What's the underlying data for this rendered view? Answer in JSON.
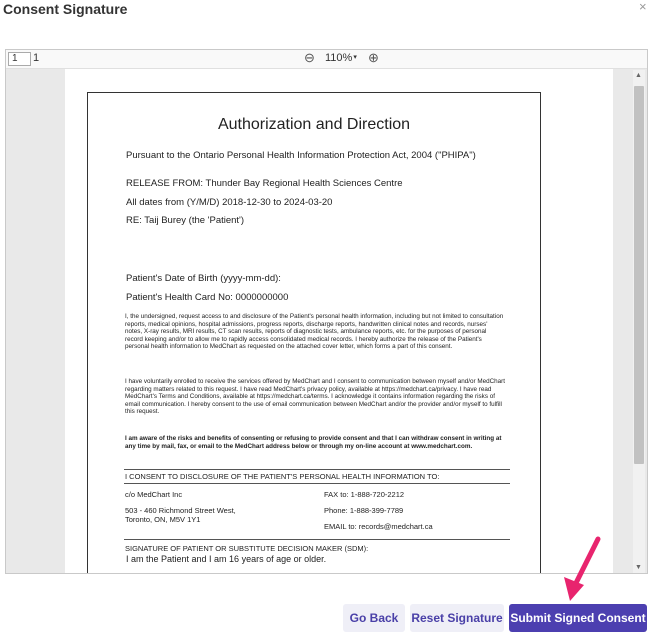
{
  "dialog": {
    "title": "Consent Signature",
    "close_label": "×"
  },
  "viewer": {
    "page_current": "1",
    "page_total": "1",
    "zoom_out_icon": "⊖",
    "zoom": "110%",
    "zoom_caret": "▾",
    "zoom_in_icon": "⊕",
    "scroll_up": "▲",
    "scroll_down": "▼"
  },
  "document": {
    "title": "Authorization and Direction",
    "pursuant": "Pursuant to the Ontario Personal Health Information Protection Act, 2004 (\"PHIPA\")",
    "release_from": "RELEASE FROM: Thunder Bay Regional Health Sciences Centre",
    "dates": "All dates from (Y/M/D) 2018-12-30 to 2024-03-20",
    "re": "RE: Taij Burey (the 'Patient')",
    "dob": "Patient's Date of Birth (yyyy-mm-dd):",
    "health_card": "Patient's Health Card No: 0000000000",
    "para1": "I, the undersigned, request access to and disclosure of the Patient's personal health information, including but not limited to consultation reports, medical opinions, hospital admissions, progress reports, discharge reports, handwritten clinical notes and records, nurses' notes, X-ray results, MRI results, CT scan results, reports of diagnostic tests, ambulance reports, etc. for the purposes of personal record keeping and/or to allow me to rapidly access consolidated medical records. I hereby authorize the release of the Patient's personal health information to MedChart as requested on the attached cover letter, which forms a part of this consent.",
    "para2": "I have voluntarily enrolled to receive the services offered by MedChart and I consent to communication between myself and/or MedChart regarding matters related to this request. I have read MedChart's privacy policy, available at https://medchart.ca/privacy. I have read MedChart's Terms and Conditions, available at https://medchart.ca/terms. I acknowledge it contains information regarding the risks of email communication. I hereby consent to the use of email communication between MedChart and/or the provider and/or myself to fulfill this request.",
    "para3": "I am aware of the risks and benefits of consenting or refusing to provide consent and that I can withdraw consent in writing at any time by mail, fax, or email to the MedChart address below or through my on-line account at www.medchart.com.",
    "consent_heading": "I CONSENT TO DISCLOSURE OF THE PATIENT'S PERSONAL HEALTH INFORMATION TO:",
    "recipient_name": "c/o MedChart Inc",
    "recipient_address": "503 - 460 Richmond Street West, Toronto, ON, M5V 1Y1",
    "fax": "FAX to: 1-888-720-2212",
    "phone": "Phone: 1-888-399-7789",
    "email": "EMAIL to: records@medchart.ca",
    "signature_heading": "SIGNATURE OF PATIENT OR SUBSTITUTE DECISION MAKER (SDM):",
    "signature_statement": "I am the Patient and I am 16 years of age or older."
  },
  "footer": {
    "go_back": "Go Back",
    "reset_signature": "Reset Signature",
    "submit": "Submit Signed Consent"
  },
  "colors": {
    "primary": "#4c3fb0",
    "secondary_bg": "#efeff7",
    "annotation_arrow": "#e8246e"
  }
}
